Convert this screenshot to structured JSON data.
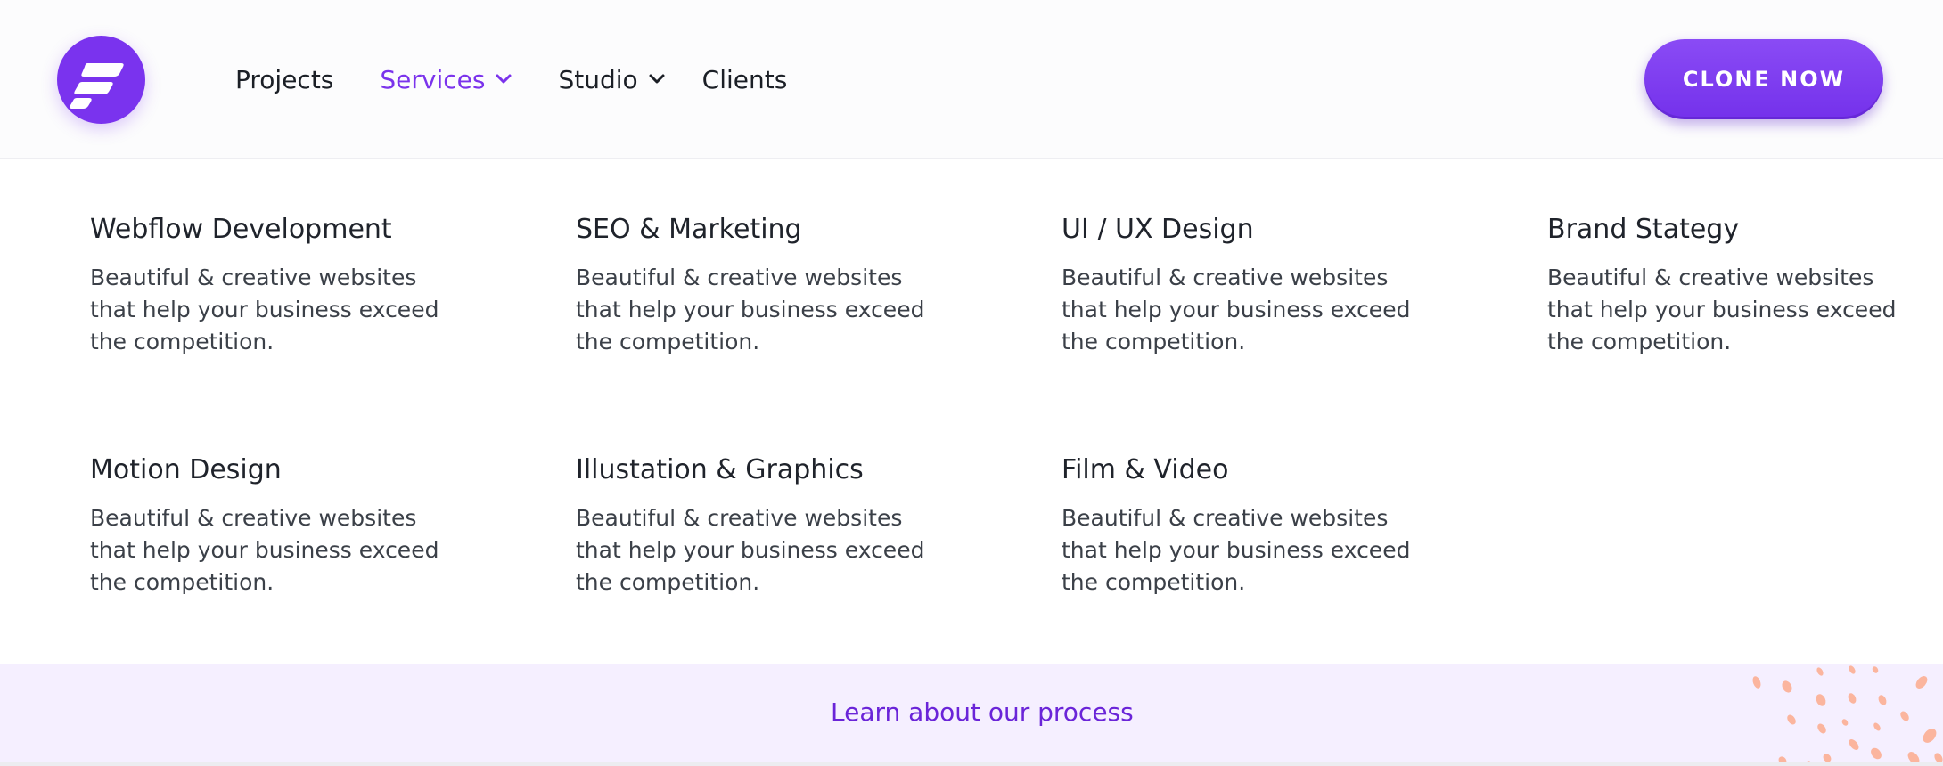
{
  "nav": {
    "logo_letter": "F",
    "links": [
      {
        "label": "Projects",
        "active": false,
        "dropdown": false
      },
      {
        "label": "Services",
        "active": true,
        "dropdown": true
      },
      {
        "label": "Studio",
        "active": false,
        "dropdown": true
      },
      {
        "label": "Clients",
        "active": false,
        "dropdown": false
      }
    ],
    "cta_label": "CLONE NOW"
  },
  "services": [
    {
      "title": "Webflow Development",
      "description": "Beautiful & creative websites that help your business exceed the competition."
    },
    {
      "title": "SEO & Marketing",
      "description": "Beautiful & creative websites that help your business exceed the competition."
    },
    {
      "title": "UI / UX Design",
      "description": "Beautiful & creative websites that help your business exceed the competition."
    },
    {
      "title": "Brand Stategy",
      "description": "Beautiful & creative websites that help your business exceed the competition."
    },
    {
      "title": "Motion Design",
      "description": "Beautiful & creative websites that help your business exceed the competition."
    },
    {
      "title": "Illustation & Graphics",
      "description": "Beautiful & creative websites that help your business exceed the competition."
    },
    {
      "title": "Film & Video",
      "description": "Beautiful & creative websites that help your business exceed the competition."
    }
  ],
  "footer": {
    "learn_link": "Learn about our process"
  },
  "colors": {
    "brand": "#7a33ee",
    "active_link": "#7b33ec",
    "footer_bg": "#f5efff",
    "dots": "#fbb59e"
  }
}
